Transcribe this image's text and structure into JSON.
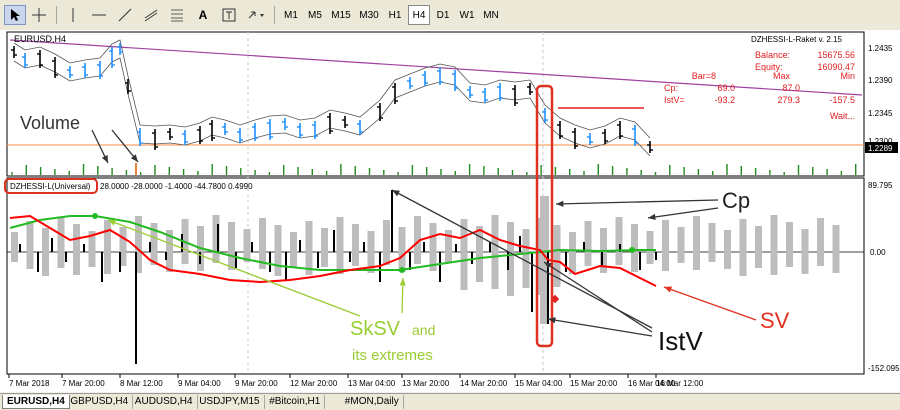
{
  "toolbar": {
    "timeframes": [
      "M1",
      "M5",
      "M15",
      "M30",
      "H1",
      "H4",
      "D1",
      "W1",
      "MN"
    ],
    "active_timeframe": "H4",
    "text_tool": "A",
    "label_tool": "T"
  },
  "chart": {
    "symbol_title": "EURUSD,H4",
    "indicator_name": "DZHESSI-L-Raket v. 2.15",
    "balance_label": "Balance:",
    "balance_value": "15675.56",
    "equity_label": "Equity:",
    "equity_value": "16090.47",
    "stats_header": [
      "Bar=8",
      "Max",
      "Min"
    ],
    "stats_rows": [
      {
        "label": "Cp:",
        "value": "69.0",
        "max": "87.0",
        "min": ""
      },
      {
        "label": "IstV=",
        "value": "-93.2",
        "max": "279.3",
        "min": "-157.5"
      }
    ],
    "status": "Wait...",
    "price_axis": [
      "1.2435",
      "1.2390",
      "1.2345",
      "1.2300",
      "1.2289"
    ],
    "current_price": "1.2289"
  },
  "subwindow": {
    "title": "DZHESSI-L(Universal)",
    "params": "28.0000 -28.0000 -1.4000 -44.7800 0.4990",
    "axis_top": "89.795",
    "axis_zero": "0.00",
    "axis_bottom": "-152.095"
  },
  "time_axis": [
    "7 Mar 2018",
    "7 Mar 20:00",
    "8 Mar 12:00",
    "9 Mar 04:00",
    "9 Mar 20:00",
    "12 Mar 20:00",
    "13 Mar 04:00",
    "13 Mar 20:00",
    "14 Mar 20:00",
    "15 Mar 04:00",
    "15 Mar 20:00",
    "16 Mar 04:00",
    "16 Mar 12:00"
  ],
  "annotations": {
    "volume": "Volume",
    "cp": "Cp",
    "sksv_line1": "SkSV",
    "sksv_and": "and",
    "sksv_line2": "its extremes",
    "istv": "IstV",
    "sv": "SV"
  },
  "tabs": [
    "EURUSD,H4",
    "GBPUSD,H4",
    "AUDUSD,H4",
    "USDJPY,M15",
    "#Bitcoin,H1",
    "#MON,Daily"
  ],
  "active_tab": "EURUSD,H4",
  "colors": {
    "bull_bar": "#1e90ff",
    "bear_bar": "#000000",
    "sv_line": "#ff0000",
    "sksv_line": "#22bb22",
    "volume": "#228b22",
    "cp_bars": "#bdbdbd",
    "annotation_red": "#e03020",
    "annotation_green": "#9acd32",
    "trendline": "#a040a0",
    "price_line": "#ff8c40"
  }
}
